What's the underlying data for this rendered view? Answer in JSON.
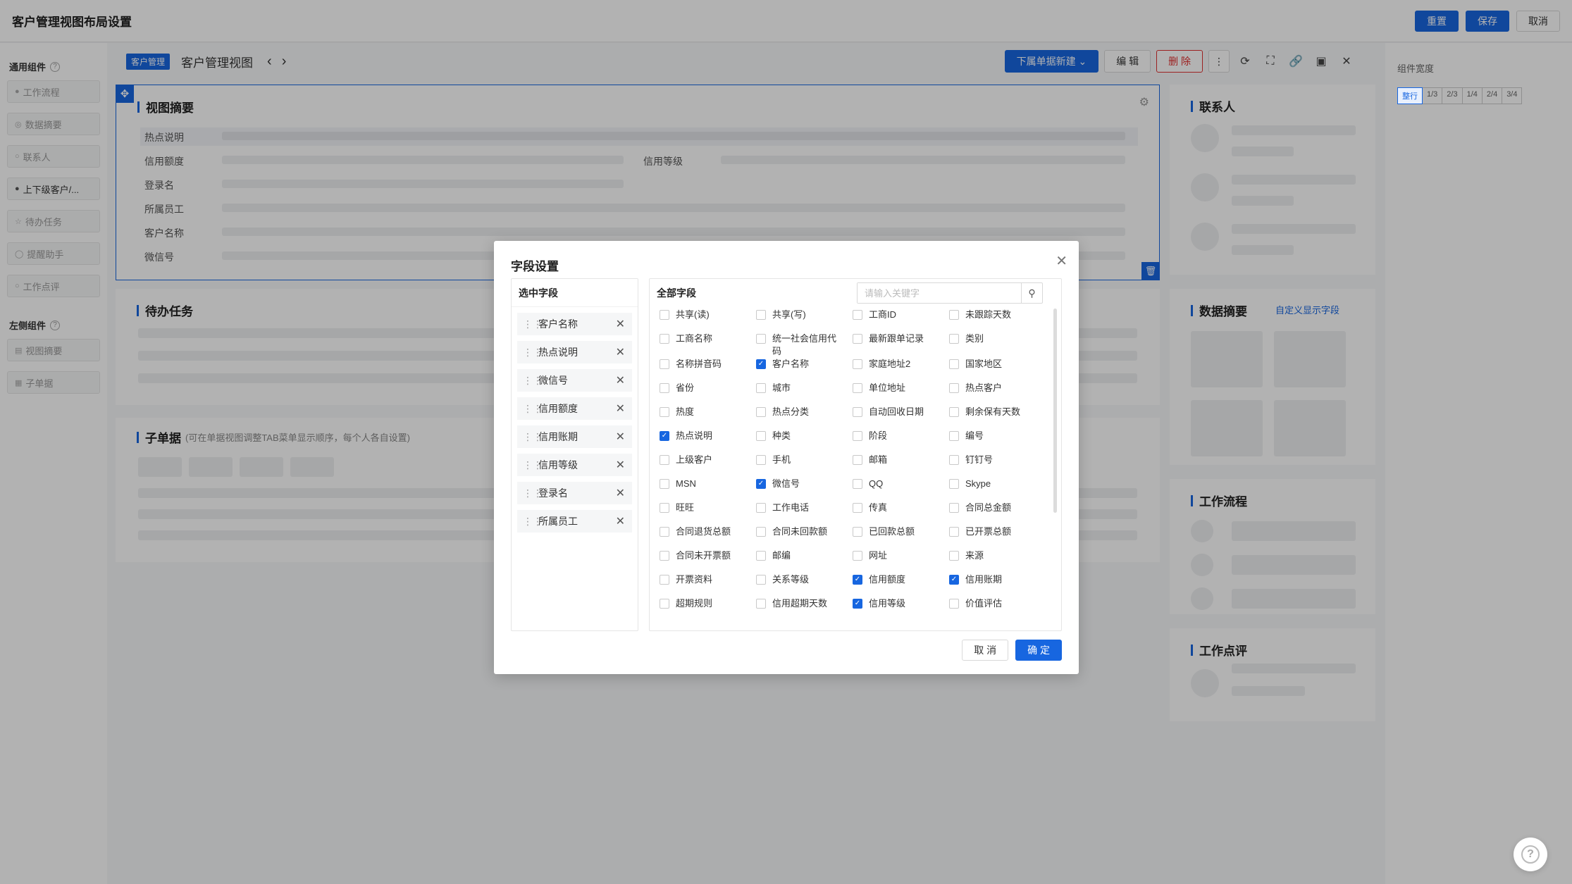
{
  "topbar": {
    "title": "客户管理视图布局设置",
    "reset": "重置",
    "save": "保存",
    "cancel": "取消"
  },
  "left": {
    "common_title": "通用组件",
    "common_items": [
      "工作流程",
      "数据摘要",
      "联系人",
      "上下级客户/...",
      "待办任务",
      "提醒助手",
      "工作点评"
    ],
    "side_title": "左侧组件",
    "side_items": [
      "视图摘要",
      "子单据"
    ]
  },
  "view": {
    "tag": "客户管理",
    "name": "客户管理视图",
    "new_sub": "下属单据新建",
    "edit": "编 辑",
    "delete": "删 除"
  },
  "summary": {
    "title": "视图摘要",
    "rows": [
      "热点说明",
      "信用额度",
      "登录名",
      "所属员工",
      "客户名称",
      "微信号"
    ],
    "credit_level": "信用等级"
  },
  "todo": {
    "title": "待办任务"
  },
  "sub": {
    "title": "子单据",
    "hint": "(可在单据视图调整TAB菜单显示顺序，每个人各自设置)"
  },
  "right_cards": {
    "contact": "联系人",
    "data": "数据摘要",
    "custom": "自定义显示字段",
    "flow": "工作流程",
    "review": "工作点评"
  },
  "right_panel": {
    "title": "组件宽度",
    "options": [
      "整行",
      "1/3",
      "2/3",
      "1/4",
      "2/4",
      "3/4"
    ],
    "selected": "整行"
  },
  "modal": {
    "title": "字段设置",
    "selected_title": "选中字段",
    "all_title": "全部字段",
    "search_placeholder": "请输入关键字",
    "selected": [
      "客户名称",
      "热点说明",
      "微信号",
      "信用额度",
      "信用账期",
      "信用等级",
      "登录名",
      "所属员工"
    ],
    "fields": [
      {
        "label": "共享(读)",
        "checked": false
      },
      {
        "label": "共享(写)",
        "checked": false
      },
      {
        "label": "工商ID",
        "checked": false
      },
      {
        "label": "未跟踪天数",
        "checked": false
      },
      {
        "label": "工商名称",
        "checked": false
      },
      {
        "label": "统一社会信用代码",
        "checked": false
      },
      {
        "label": "最新跟单记录",
        "checked": false
      },
      {
        "label": "类别",
        "checked": false
      },
      {
        "label": "名称拼音码",
        "checked": false
      },
      {
        "label": "客户名称",
        "checked": true
      },
      {
        "label": "家庭地址2",
        "checked": false
      },
      {
        "label": "国家地区",
        "checked": false
      },
      {
        "label": "省份",
        "checked": false
      },
      {
        "label": "城市",
        "checked": false
      },
      {
        "label": "单位地址",
        "checked": false
      },
      {
        "label": "热点客户",
        "checked": false
      },
      {
        "label": "热度",
        "checked": false
      },
      {
        "label": "热点分类",
        "checked": false
      },
      {
        "label": "自动回收日期",
        "checked": false
      },
      {
        "label": "剩余保有天数",
        "checked": false
      },
      {
        "label": "热点说明",
        "checked": true
      },
      {
        "label": "种类",
        "checked": false
      },
      {
        "label": "阶段",
        "checked": false
      },
      {
        "label": "编号",
        "checked": false
      },
      {
        "label": "上级客户",
        "checked": false
      },
      {
        "label": "手机",
        "checked": false
      },
      {
        "label": "邮箱",
        "checked": false
      },
      {
        "label": "钉钉号",
        "checked": false
      },
      {
        "label": "MSN",
        "checked": false
      },
      {
        "label": "微信号",
        "checked": true
      },
      {
        "label": "QQ",
        "checked": false
      },
      {
        "label": "Skype",
        "checked": false
      },
      {
        "label": "旺旺",
        "checked": false
      },
      {
        "label": "工作电话",
        "checked": false
      },
      {
        "label": "传真",
        "checked": false
      },
      {
        "label": "合同总金额",
        "checked": false
      },
      {
        "label": "合同退货总额",
        "checked": false
      },
      {
        "label": "合同未回款额",
        "checked": false
      },
      {
        "label": "已回款总额",
        "checked": false
      },
      {
        "label": "已开票总额",
        "checked": false
      },
      {
        "label": "合同未开票额",
        "checked": false
      },
      {
        "label": "邮编",
        "checked": false
      },
      {
        "label": "网址",
        "checked": false
      },
      {
        "label": "来源",
        "checked": false
      },
      {
        "label": "开票资料",
        "checked": false
      },
      {
        "label": "关系等级",
        "checked": false
      },
      {
        "label": "信用额度",
        "checked": true
      },
      {
        "label": "信用账期",
        "checked": true
      },
      {
        "label": "超期规则",
        "checked": false
      },
      {
        "label": "信用超期天数",
        "checked": false
      },
      {
        "label": "信用等级",
        "checked": true
      },
      {
        "label": "价值评估",
        "checked": false
      }
    ],
    "cancel": "取 消",
    "ok": "确 定"
  }
}
